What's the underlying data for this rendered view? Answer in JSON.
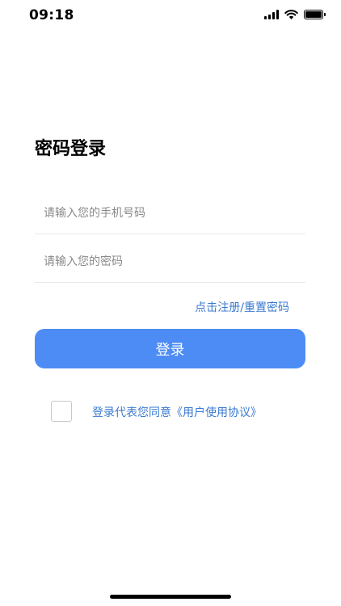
{
  "status_bar": {
    "time": "09:18",
    "icons": [
      "signal-icon",
      "wifi-icon",
      "battery-icon"
    ]
  },
  "login": {
    "title": "密码登录",
    "phone_placeholder": "请输入您的手机号码",
    "phone_value": "",
    "password_placeholder": "请输入您的密码",
    "password_value": "",
    "register_link": "点击注册/重置密码",
    "login_button": "登录",
    "agreement_checked": false,
    "agreement_text": "登录代表您同意《用户使用协议》"
  },
  "colors": {
    "primary": "#4d8cf5",
    "link": "#3b7ad0",
    "divider": "#e9e9e9"
  }
}
